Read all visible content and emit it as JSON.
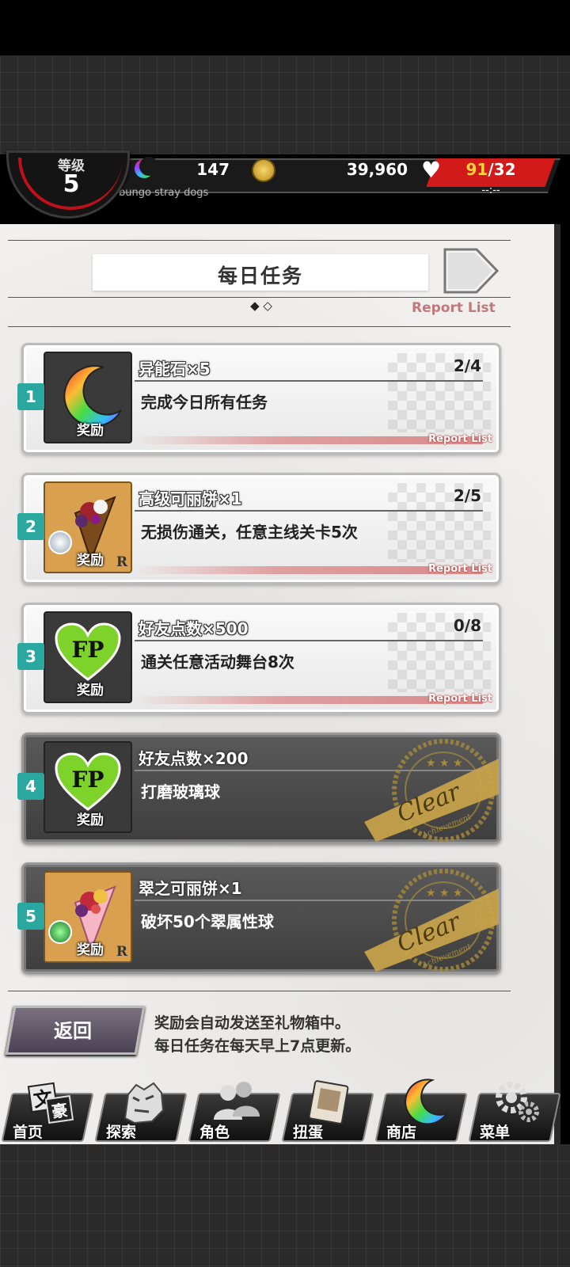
{
  "status": {
    "level_label": "等级",
    "level": "5",
    "stones": "147",
    "coins": "39,960",
    "stamina_current": "91",
    "stamina_max": "/32",
    "stamina_timer": "--:--",
    "subtitle": "bungo stray dogs"
  },
  "header": {
    "title": "每日任务",
    "pager": "◆ ◇",
    "report_list": "Report List"
  },
  "missions": [
    {
      "index": "1",
      "reward": "异能石×5",
      "progress": "2/4",
      "desc": "完成今日所有任务",
      "reward_label": "奖励",
      "report": "Report List",
      "icon": "moon-stone-icon",
      "state": "in-progress"
    },
    {
      "index": "2",
      "reward": "高级可丽饼×1",
      "progress": "2/5",
      "desc": "无损伤通关，任意主线关卡5次",
      "reward_label": "奖励",
      "report": "Report List",
      "rarity": "R",
      "icon": "crepe-icon",
      "state": "in-progress"
    },
    {
      "index": "3",
      "reward": "好友点数×500",
      "progress": "0/8",
      "desc": "通关任意活动舞台8次",
      "reward_label": "奖励",
      "report": "Report List",
      "icon": "fp-heart-icon",
      "state": "in-progress"
    },
    {
      "index": "4",
      "reward": "好友点数×200",
      "desc": "打磨玻璃球",
      "reward_label": "奖励",
      "icon": "fp-heart-icon",
      "state": "clear",
      "stamp_text": "Clear",
      "stamp_sub": "Achievement"
    },
    {
      "index": "5",
      "reward": "翠之可丽饼×1",
      "desc": "破坏50个翠属性球",
      "reward_label": "奖励",
      "rarity": "R",
      "icon": "green-crepe-icon",
      "state": "clear",
      "stamp_text": "Clear",
      "stamp_sub": "Achievement"
    }
  ],
  "footer": {
    "back": "返回",
    "note1": "奖励会自动发送至礼物箱中。",
    "note2": "每日任务在每天早上7点更新。"
  },
  "nav": [
    {
      "label": "首页",
      "icon": "home-icon"
    },
    {
      "label": "探索",
      "icon": "tiger-icon"
    },
    {
      "label": "角色",
      "icon": "characters-icon"
    },
    {
      "label": "扭蛋",
      "icon": "gacha-book-icon"
    },
    {
      "label": "商店",
      "icon": "shop-moon-icon"
    },
    {
      "label": "菜单",
      "icon": "gear-icon"
    }
  ],
  "colors": {
    "accent_teal": "#2aa8a0",
    "stamina_red": "#d31a1a",
    "report_pink": "#c07878",
    "stamp_gold": "#c9a44a"
  }
}
